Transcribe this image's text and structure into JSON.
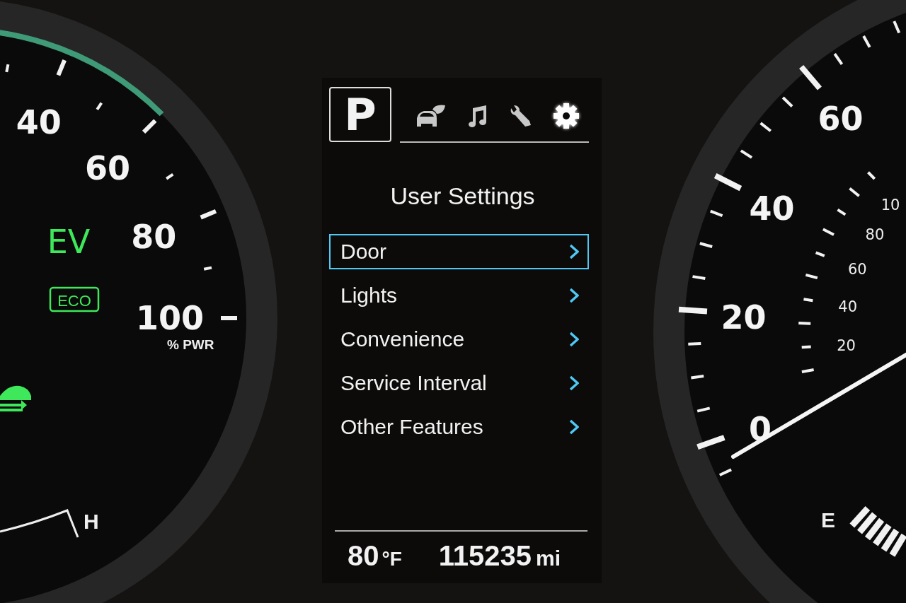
{
  "power_gauge": {
    "scale_labels": [
      "40",
      "60",
      "80",
      "100"
    ],
    "unit": "% PWR",
    "drive_mode": "EV",
    "eco_badge": "ECO",
    "temp_label": "H"
  },
  "info_display": {
    "gear": "P",
    "tabs": [
      {
        "kind": "eco",
        "selected": false
      },
      {
        "kind": "media",
        "selected": false
      },
      {
        "kind": "service",
        "selected": false
      },
      {
        "kind": "settings",
        "selected": true
      }
    ],
    "title": "User Settings",
    "menu": [
      {
        "label": "Door",
        "selected": true
      },
      {
        "label": "Lights",
        "selected": false
      },
      {
        "label": "Convenience",
        "selected": false
      },
      {
        "label": "Service Interval",
        "selected": false
      },
      {
        "label": "Other Features",
        "selected": false
      }
    ],
    "temperature": {
      "value": "80",
      "unit": "°F"
    },
    "odometer": {
      "value": "115235",
      "unit": "mi"
    }
  },
  "speedometer": {
    "mph_labels": [
      "60",
      "40",
      "20",
      "0"
    ],
    "kmh_labels": [
      "10",
      "80",
      "60",
      "40",
      "20"
    ],
    "fuel_label": "E"
  }
}
